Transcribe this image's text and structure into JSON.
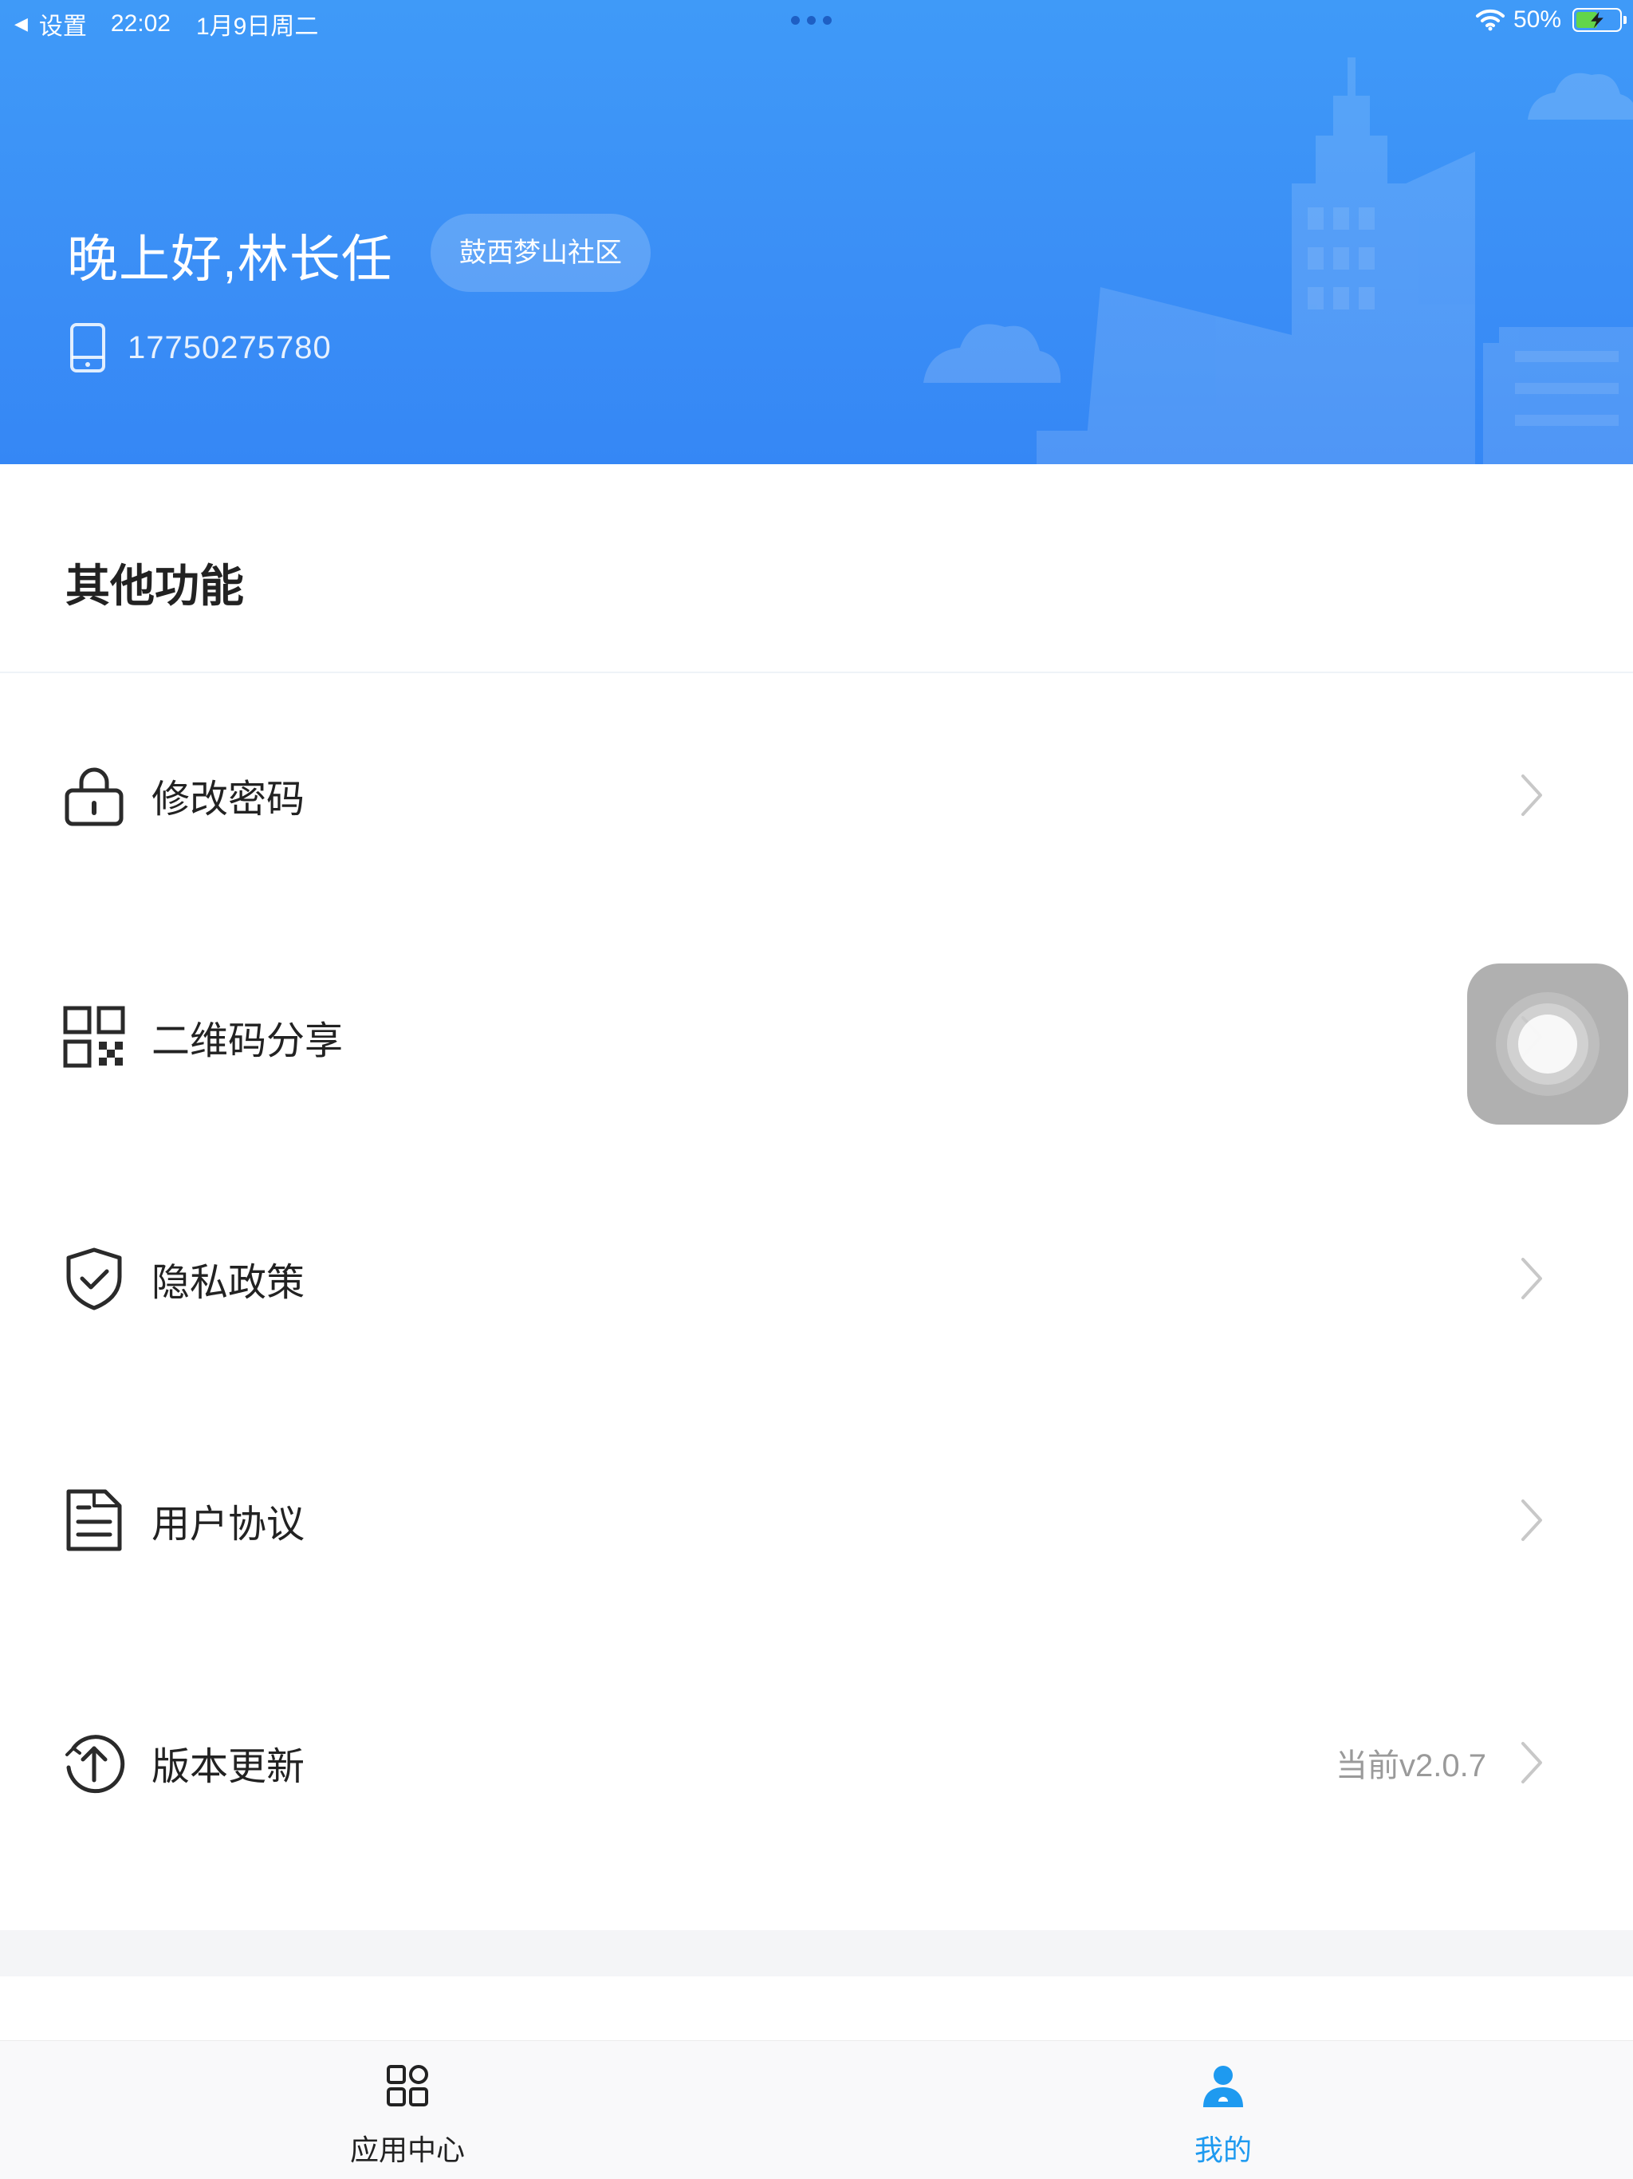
{
  "status_bar": {
    "back_label": "设置",
    "time": "22:02",
    "date": "1月9日周二",
    "battery": "50%",
    "battery_level": 0.5
  },
  "header": {
    "greeting": "晚上好,林长任",
    "community": "鼓西梦山社区",
    "phone": "17750275780"
  },
  "section": {
    "title": "其他功能"
  },
  "menu": [
    {
      "label": "修改密码",
      "icon": "lock-icon"
    },
    {
      "label": "二维码分享",
      "icon": "qr-code-icon"
    },
    {
      "label": "隐私政策",
      "icon": "shield-check-icon"
    },
    {
      "label": "用户协议",
      "icon": "document-icon"
    },
    {
      "label": "版本更新",
      "icon": "upload-circle-icon",
      "value": "当前v2.0.7"
    }
  ],
  "tabs": [
    {
      "label": "应用中心",
      "icon": "grid-icon",
      "active": false
    },
    {
      "label": "我的",
      "icon": "user-icon",
      "active": true
    }
  ],
  "colors": {
    "header_blue": "#3b8ff6",
    "active_tab": "#1e9af0",
    "inactive_tab": "#222222",
    "icon_stroke": "#2a2a2a"
  }
}
